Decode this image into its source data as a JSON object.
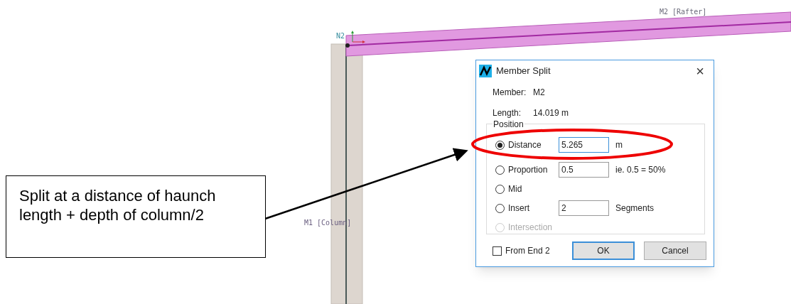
{
  "canvas": {
    "labels": [
      {
        "kind": "node",
        "text": "N2"
      },
      {
        "kind": "rafter",
        "text": "M2 [Rafter]"
      },
      {
        "kind": "column",
        "text": "M1 [Column]"
      }
    ]
  },
  "callout": {
    "text": "Split at a distance of haunch length + depth of column/2"
  },
  "dialog": {
    "title": "Member Split",
    "close": "×",
    "info": [
      {
        "label": "Member:",
        "value": "M2"
      },
      {
        "label": "Length:",
        "value": "14.019 m"
      }
    ],
    "group_label": "Position",
    "options": [
      {
        "label": "Distance",
        "selected": true,
        "disabled": false,
        "value": "5.265",
        "unit": "m"
      },
      {
        "label": "Proportion",
        "selected": false,
        "disabled": false,
        "value": "0.5",
        "unit": "ie. 0.5 = 50%"
      },
      {
        "label": "Mid",
        "selected": false,
        "disabled": false
      },
      {
        "label": "Insert",
        "selected": false,
        "disabled": false,
        "value": "2",
        "unit": "Segments"
      },
      {
        "label": "Intersection",
        "selected": false,
        "disabled": true
      }
    ],
    "from_end": {
      "label": "From End 2",
      "checked": false
    },
    "buttons": [
      {
        "label": "OK",
        "default": true
      },
      {
        "label": "Cancel",
        "default": false
      }
    ]
  }
}
